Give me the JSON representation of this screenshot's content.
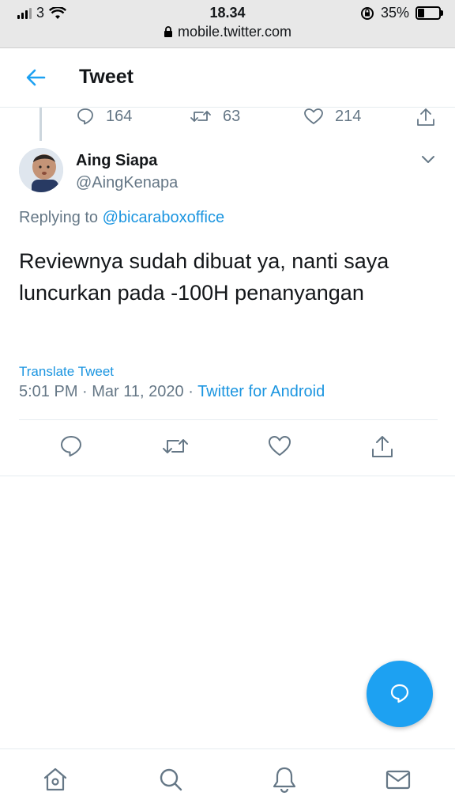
{
  "status_bar": {
    "carrier": "3",
    "time": "18.34",
    "battery": "35%",
    "battery_level": 0.35,
    "url": "mobile.twitter.com"
  },
  "header": {
    "title": "Tweet"
  },
  "previous_tweet_stats": {
    "replies": "164",
    "retweets": "63",
    "likes": "214"
  },
  "tweet": {
    "name": "Aing Siapa",
    "handle": "@AingKenapa",
    "replying_prefix": "Replying to",
    "replying_to": "@bicaraboxoffice",
    "text": "Reviewnya sudah dibuat ya, nanti saya luncurkan pada -100H penanyangan",
    "translate": "Translate Tweet",
    "time": "5:01 PM",
    "date": "Mar 11, 2020",
    "source": "Twitter for Android"
  },
  "colors": {
    "accent": "#1da1f2",
    "link": "#1b95e0",
    "secondary": "#657786"
  }
}
